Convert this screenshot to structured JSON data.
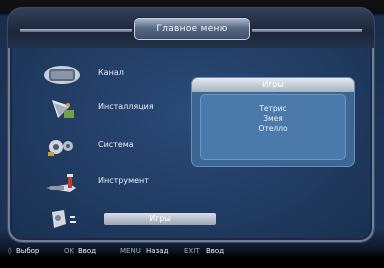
{
  "window": {
    "title": "Главное меню"
  },
  "menu": {
    "items": [
      {
        "label": "Канал",
        "icon": "tv-icon"
      },
      {
        "label": "Инсталляция",
        "icon": "satellite-dish-icon"
      },
      {
        "label": "Система",
        "icon": "gears-icon"
      },
      {
        "label": "Инструмент",
        "icon": "tools-icon"
      },
      {
        "label": "Игры",
        "icon": "gamepad-icon",
        "selected": true
      }
    ]
  },
  "submenu": {
    "title": "Игры",
    "items": [
      "Тетрис",
      "Змея",
      "Отелло"
    ]
  },
  "footer": {
    "hints": [
      {
        "key": "◊",
        "label": "Выбор"
      },
      {
        "key": "OK",
        "label": "Ввод"
      },
      {
        "key": "MENU",
        "label": "Назад"
      },
      {
        "key": "EXIT",
        "label": "Ввод"
      }
    ]
  },
  "colors": {
    "background": "#1d355a",
    "accent": "#4a79aa",
    "selection": "#c7ccd6"
  }
}
